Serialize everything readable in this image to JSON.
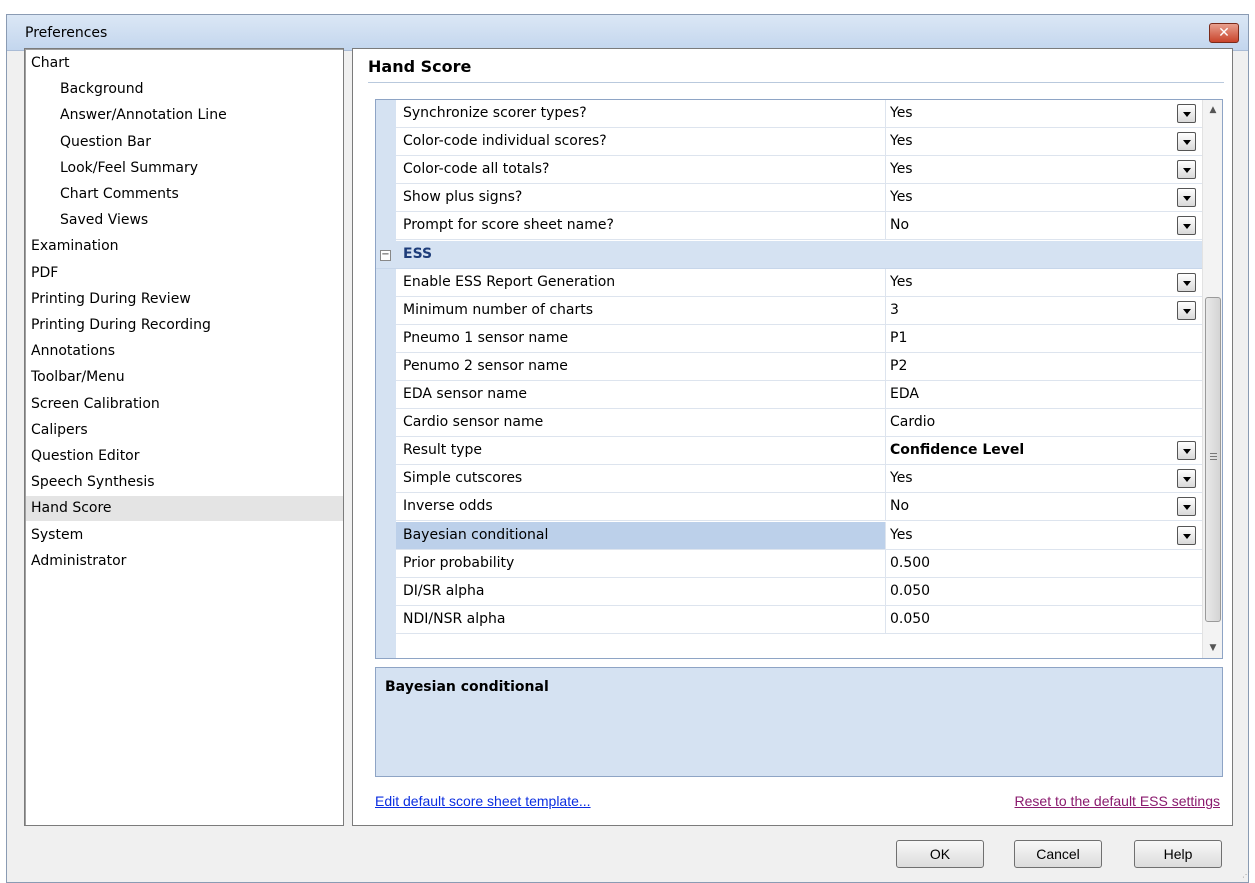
{
  "window": {
    "title": "Preferences",
    "close_symbol": "✕"
  },
  "nav": {
    "items": [
      {
        "label": "Chart",
        "level": 0
      },
      {
        "label": "Background",
        "level": 1
      },
      {
        "label": "Answer/Annotation Line",
        "level": 1
      },
      {
        "label": "Question Bar",
        "level": 1
      },
      {
        "label": "Look/Feel Summary",
        "level": 1
      },
      {
        "label": "Chart Comments",
        "level": 1
      },
      {
        "label": "Saved Views",
        "level": 1
      },
      {
        "label": "Examination",
        "level": 0
      },
      {
        "label": "PDF",
        "level": 0
      },
      {
        "label": "Printing During Review",
        "level": 0
      },
      {
        "label": "Printing During Recording",
        "level": 0
      },
      {
        "label": "Annotations",
        "level": 0
      },
      {
        "label": "Toolbar/Menu",
        "level": 0
      },
      {
        "label": "Screen Calibration",
        "level": 0
      },
      {
        "label": "Calipers",
        "level": 0
      },
      {
        "label": "Question Editor",
        "level": 0
      },
      {
        "label": "Speech Synthesis",
        "level": 0
      },
      {
        "label": "Hand Score",
        "level": 0,
        "selected": true
      },
      {
        "label": "System",
        "level": 0
      },
      {
        "label": "Administrator",
        "level": 0
      }
    ]
  },
  "panel": {
    "title": "Hand Score",
    "rows_top": [
      {
        "name": "Synchronize scorer types?",
        "value": "Yes",
        "dropdown": true
      },
      {
        "name": "Color-code individual scores?",
        "value": "Yes",
        "dropdown": true
      },
      {
        "name": "Color-code all totals?",
        "value": "Yes",
        "dropdown": true
      },
      {
        "name": "Show plus signs?",
        "value": "Yes",
        "dropdown": true
      },
      {
        "name": "Prompt for score sheet name?",
        "value": "No",
        "dropdown": true
      }
    ],
    "category": {
      "label": "ESS",
      "toggle": "−"
    },
    "rows_ess": [
      {
        "name": "Enable ESS Report Generation",
        "value": "Yes",
        "dropdown": true
      },
      {
        "name": "Minimum number of charts",
        "value": "3",
        "dropdown": true
      },
      {
        "name": "Pneumo 1 sensor name",
        "value": "P1",
        "dropdown": false
      },
      {
        "name": "Penumo 2 sensor name",
        "value": "P2",
        "dropdown": false
      },
      {
        "name": "EDA sensor name",
        "value": "EDA",
        "dropdown": false
      },
      {
        "name": "Cardio sensor name",
        "value": "Cardio",
        "dropdown": false
      },
      {
        "name": "Result type",
        "value": "Confidence Level",
        "dropdown": true,
        "bold": true
      },
      {
        "name": "Simple cutscores",
        "value": "Yes",
        "dropdown": true
      },
      {
        "name": "Inverse odds",
        "value": "No",
        "dropdown": true
      },
      {
        "name": "Bayesian conditional",
        "value": "Yes",
        "dropdown": true,
        "selected": true
      },
      {
        "name": "Prior probability",
        "value": "0.500",
        "dropdown": false
      },
      {
        "name": "DI/SR alpha",
        "value": "0.050",
        "dropdown": false
      },
      {
        "name": "NDI/NSR alpha",
        "value": "0.050",
        "dropdown": false
      }
    ],
    "description": "Bayesian conditional",
    "link_edit": "Edit default score sheet template...",
    "link_reset": "Reset to the default ESS settings"
  },
  "buttons": {
    "ok": "OK",
    "cancel": "Cancel",
    "help": "Help"
  },
  "scroll": {
    "up": "▲",
    "down": "▼"
  },
  "colors": {
    "accent": "#d5e2f2",
    "selection": "#bcd0ea",
    "link": "#0b2ee0",
    "visited_link": "#8a1a6e"
  }
}
